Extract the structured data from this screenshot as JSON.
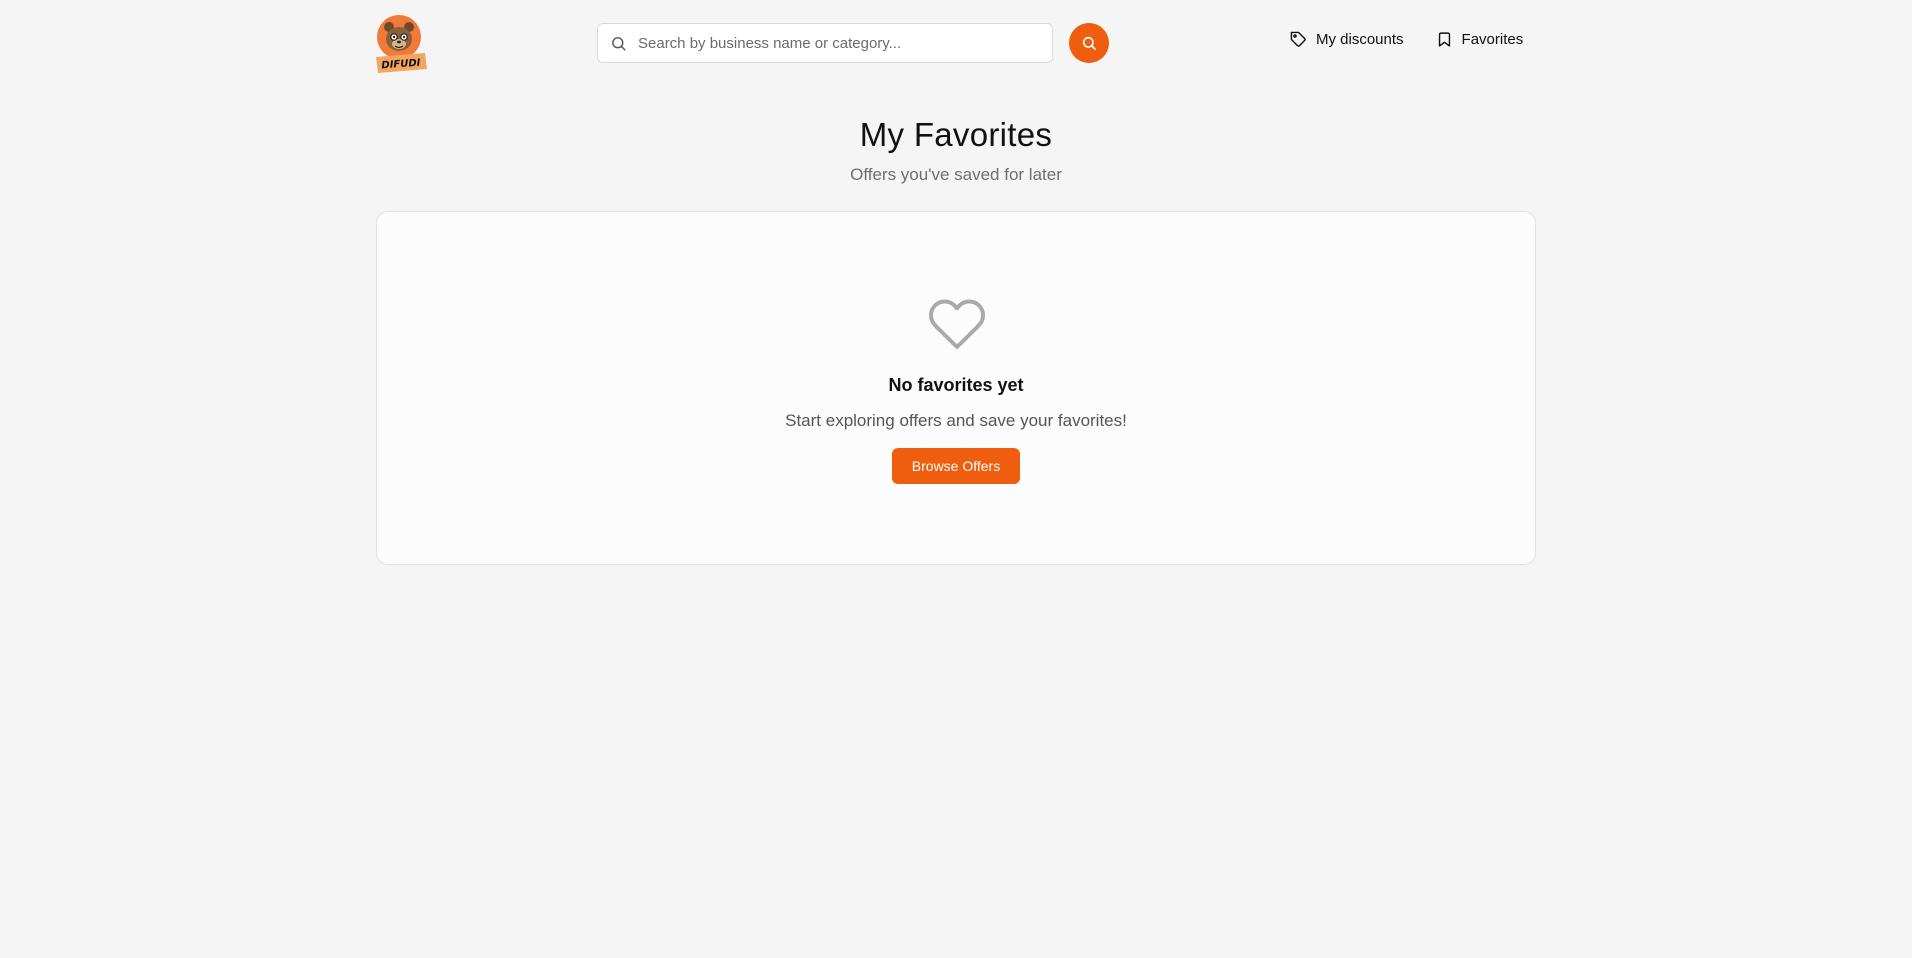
{
  "brand": {
    "logo_text": "DIFUDI",
    "accent_color": "#ef5d0e"
  },
  "search": {
    "placeholder": "Search by business name or category...",
    "value": ""
  },
  "nav": {
    "discounts_label": "My discounts",
    "favorites_label": "Favorites"
  },
  "page": {
    "title": "My Favorites",
    "subtitle": "Offers you've saved for later"
  },
  "empty_state": {
    "icon": "heart-icon",
    "title": "No favorites yet",
    "text": "Start exploring offers and save your favorites!",
    "button_label": "Browse Offers"
  }
}
